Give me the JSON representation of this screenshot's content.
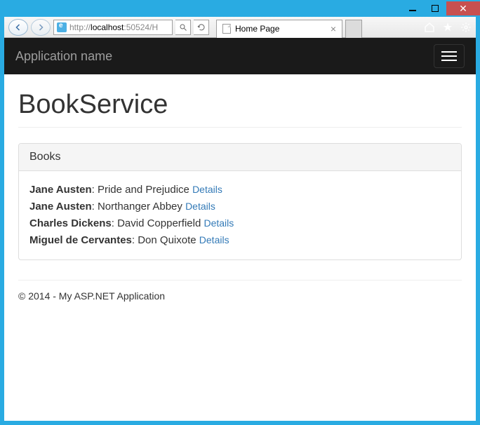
{
  "window": {
    "url_prefix": "http://",
    "url_host": "localhost",
    "url_port_path": ":50524/H",
    "tab_title": "Home Page"
  },
  "navbar": {
    "brand": "Application name"
  },
  "page": {
    "title": "BookService"
  },
  "panel": {
    "heading": "Books",
    "details_label": "Details"
  },
  "books": [
    {
      "author": "Jane Austen",
      "title": "Pride and Prejudice"
    },
    {
      "author": "Jane Austen",
      "title": "Northanger Abbey"
    },
    {
      "author": "Charles Dickens",
      "title": "David Copperfield"
    },
    {
      "author": "Miguel de Cervantes",
      "title": "Don Quixote"
    }
  ],
  "footer": {
    "text": "© 2014 - My ASP.NET Application"
  }
}
